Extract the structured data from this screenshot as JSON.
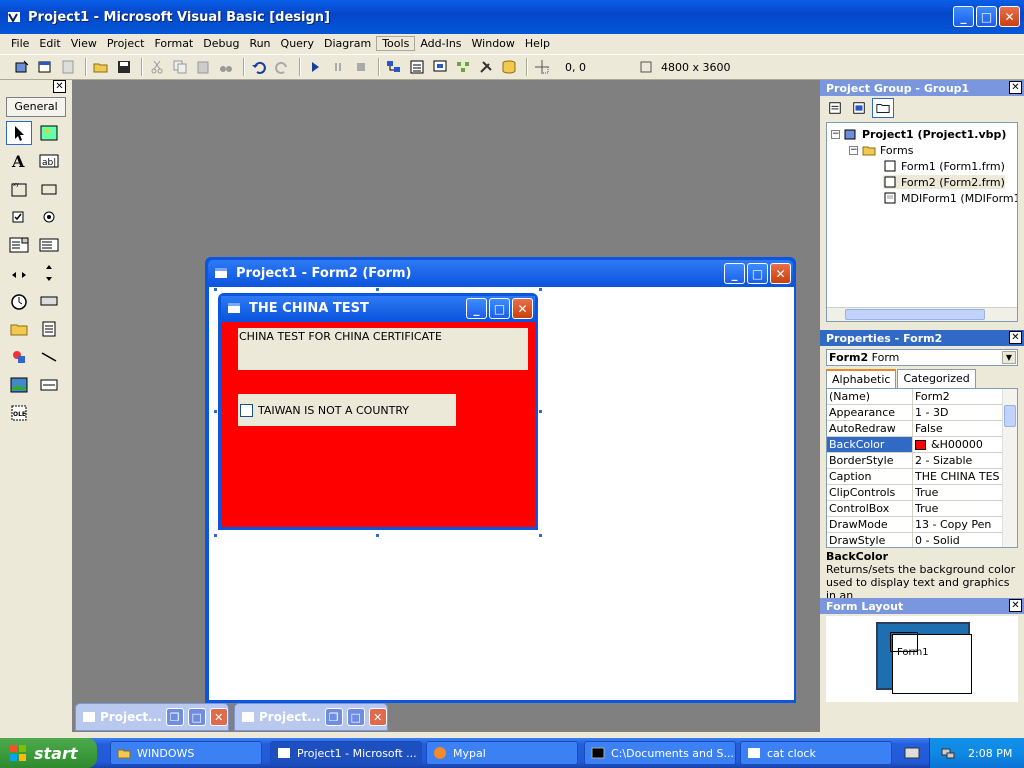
{
  "window": {
    "title": "Project1 - Microsoft Visual Basic [design]"
  },
  "menu": [
    "File",
    "Edit",
    "View",
    "Project",
    "Format",
    "Debug",
    "Run",
    "Query",
    "Diagram",
    "Tools",
    "Add-Ins",
    "Window",
    "Help"
  ],
  "toolbar": {
    "position": "0, 0",
    "size": "4800 x 3600"
  },
  "toolbox": {
    "tab": "General",
    "close": "✕"
  },
  "designer": {
    "title": "Project1 - Form2 (Form)",
    "form": {
      "caption": "THE CHINA TEST",
      "backcolor": "#ff0000",
      "label": "CHINA TEST FOR CHINA CERTIFICATE",
      "checkbox": "TAIWAN IS NOT A COUNTRY"
    }
  },
  "project_group": {
    "title": "Project Group - Group1",
    "project": "Project1 (Project1.vbp)",
    "folder": "Forms",
    "items": [
      "Form1 (Form1.frm)",
      "Form2 (Form2.frm)",
      "MDIForm1 (MDIForm1.f"
    ]
  },
  "properties": {
    "title": "Properties - Form2",
    "object_bold": "Form2",
    "object_type": "Form",
    "tabs": [
      "Alphabetic",
      "Categorized"
    ],
    "rows": [
      {
        "k": "(Name)",
        "v": "Form2"
      },
      {
        "k": "Appearance",
        "v": "1 - 3D"
      },
      {
        "k": "AutoRedraw",
        "v": "False"
      },
      {
        "k": "BackColor",
        "v": "&H00000"
      },
      {
        "k": "BorderStyle",
        "v": "2 - Sizable"
      },
      {
        "k": "Caption",
        "v": "THE CHINA TES"
      },
      {
        "k": "ClipControls",
        "v": "True"
      },
      {
        "k": "ControlBox",
        "v": "True"
      },
      {
        "k": "DrawMode",
        "v": "13 - Copy Pen"
      },
      {
        "k": "DrawStyle",
        "v": "0 - Solid"
      }
    ],
    "desc_title": "BackColor",
    "desc_text": "Returns/sets the background color used to display text and graphics in an"
  },
  "form_layout": {
    "title": "Form Layout",
    "mini_label": "Form1"
  },
  "mdi_minimized": [
    "Project...",
    "Project..."
  ],
  "taskbar": {
    "start": "start",
    "buttons": [
      "WINDOWS",
      "Project1 - Microsoft ...",
      "Mypal",
      "C:\\Documents and S...",
      "cat clock"
    ],
    "clock": "2:08 PM"
  }
}
